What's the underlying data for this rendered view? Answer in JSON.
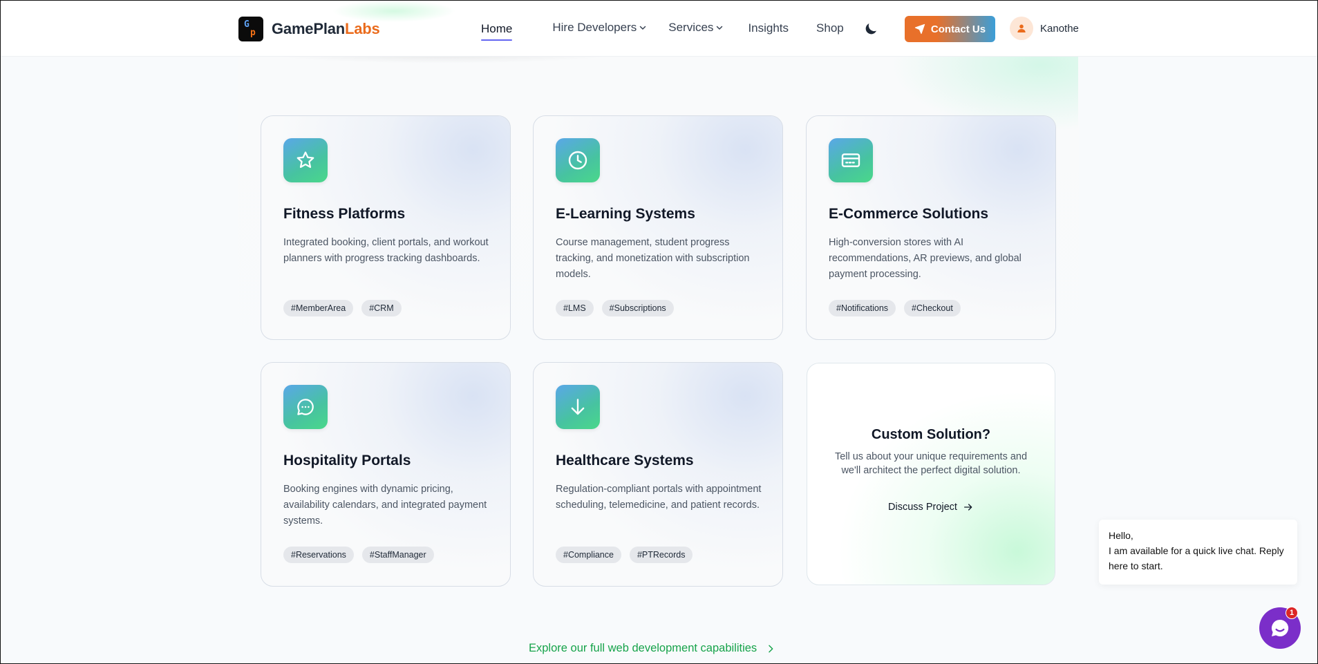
{
  "header": {
    "brand_main": "GamePlan",
    "brand_accent": "Labs",
    "logo_glyph_top": "G",
    "logo_glyph_bottom": "p",
    "nav": [
      {
        "label": "Home",
        "active": true
      },
      {
        "label": "Hire Developers",
        "has_dropdown": true
      },
      {
        "label": "Services",
        "has_dropdown": true
      },
      {
        "label": "Insights"
      },
      {
        "label": "Shop"
      }
    ],
    "theme_toggle_icon": "moon-icon",
    "contact_label": "Contact Us",
    "contact_icon": "send-icon",
    "user_name": "Kanothe",
    "colors": {
      "accent_orange": "#e8702a",
      "accent_blue": "#3b9ed8",
      "nav_underline": "#6366f1"
    }
  },
  "cards": [
    {
      "icon": "star-icon",
      "title": "Fitness Platforms",
      "description": "Integrated booking, client portals, and workout planners with progress tracking dashboards.",
      "tags": [
        "#MemberArea",
        "#CRM"
      ]
    },
    {
      "icon": "clock-icon",
      "title": "E-Learning Systems",
      "description": "Course management, student progress tracking, and monetization with subscription models.",
      "tags": [
        "#LMS",
        "#Subscriptions"
      ]
    },
    {
      "icon": "credit-card-icon",
      "title": "E-Commerce Solutions",
      "description": "High-conversion stores with AI recommendations, AR previews, and global payment processing.",
      "tags": [
        "#Notifications",
        "#Checkout"
      ]
    },
    {
      "icon": "chat-icon",
      "title": "Hospitality Portals",
      "description": "Booking engines with dynamic pricing, availability calendars, and integrated payment systems.",
      "tags": [
        "#Reservations",
        "#StaffManager"
      ]
    },
    {
      "icon": "arrow-down-icon",
      "title": "Healthcare Systems",
      "description": "Regulation-compliant portals with appointment scheduling, telemedicine, and patient records.",
      "tags": [
        "#Compliance",
        "#PTRecords"
      ]
    }
  ],
  "custom": {
    "title": "Custom Solution?",
    "description": "Tell us about your unique requirements and we'll architect the perfect digital solution.",
    "cta": "Discuss Project"
  },
  "explore_link": "Explore our full web development capabilities",
  "chat": {
    "greeting": "Hello,",
    "message": "I am available for a quick live chat. Reply here to start.",
    "badge_count": "1",
    "color": "#7b2ec9"
  }
}
